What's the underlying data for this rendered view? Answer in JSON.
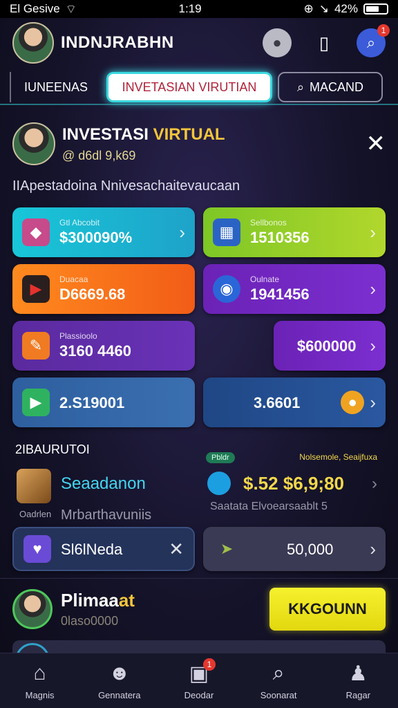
{
  "statusbar": {
    "carrier": "El Gesive",
    "time": "1:19",
    "battery": "42%"
  },
  "header": {
    "title": "INDNJRABHN",
    "notif_count": "1"
  },
  "tabs": [
    {
      "label": "IUNEENAS"
    },
    {
      "label": "INVETASIAN VIRUTIAN"
    },
    {
      "label": "MACAND"
    }
  ],
  "profile": {
    "name_prefix": "INVESTASI ",
    "name_highlight": "VIRTUAL",
    "handle": "@ d6dl 9,k69"
  },
  "subtitle": "IIApestadoina Nnivesachaitevaucaan",
  "cards": [
    {
      "label": "Gtl Abcobit",
      "value": "$300090%"
    },
    {
      "label": "Sellbonos",
      "value": "1510356"
    },
    {
      "label": "Duacaa",
      "value": "D6669.68"
    },
    {
      "label": "Oulnate",
      "value": "1941456"
    },
    {
      "label": "Plassioolo",
      "value": "3160 4460"
    },
    {
      "label": "",
      "value": "$600000"
    },
    {
      "label": "",
      "value": "2.S19001"
    },
    {
      "label": "",
      "value": "3.6601"
    }
  ],
  "section": {
    "title": "2IBAURUTOI"
  },
  "mid": {
    "left_title": "Seaadanon",
    "left_small": "Oadrlen",
    "left_sub": "Mrbarthavuniis",
    "pill": "Pbldr",
    "yellow_label": "Nolsemole, Seaijfuxa",
    "big_value": "$.52 $6,9;80",
    "right_sub": "Saatata Elvoearsaablt 5"
  },
  "row2": {
    "left_value": "Sl6lNeda",
    "right_value": "50,000"
  },
  "user": {
    "name_prefix": "Plimaa",
    "name_highlight": "at",
    "sub": "0laso0000",
    "cta": "KKGOUNN"
  },
  "bottomnav": [
    {
      "label": "Magnis"
    },
    {
      "label": "Gennatera"
    },
    {
      "label": "Deodar",
      "badge": "1"
    },
    {
      "label": "Soonarat"
    },
    {
      "label": "Ragar"
    }
  ],
  "colors": {
    "accent_cyan": "#3ad8df",
    "accent_yellow": "#f3c53b",
    "cta_yellow": "#f6f12e"
  }
}
